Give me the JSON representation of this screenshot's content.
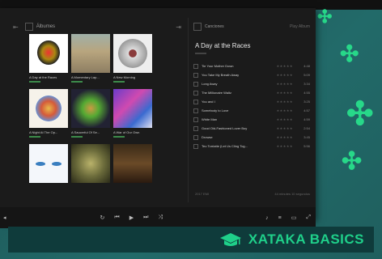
{
  "app": {
    "albums_pane": {
      "title": "Álbumes"
    },
    "albums": [
      {
        "label": "A Day at the Races"
      },
      {
        "label": "A Momentary Lap..."
      },
      {
        "label": "A New Morning"
      },
      {
        "label": "A Night At The Op..."
      },
      {
        "label": "A Saucerful Of Se..."
      },
      {
        "label": "A War of Our Own"
      },
      {
        "label": ""
      },
      {
        "label": ""
      },
      {
        "label": ""
      }
    ],
    "tracks_pane": {
      "title": "Canciones",
      "action": "Play Album",
      "album_title": "A Day at the Races"
    },
    "tracks": [
      {
        "name": "Tie Your Mother Down",
        "time": "4:48"
      },
      {
        "name": "You Take My Breath Away",
        "time": "5:09"
      },
      {
        "name": "Long Away",
        "time": "3:34"
      },
      {
        "name": "The Millionaire Waltz",
        "time": "4:55"
      },
      {
        "name": "You and I",
        "time": "3:25"
      },
      {
        "name": "Somebody to Love",
        "time": "4:57"
      },
      {
        "name": "White Man",
        "time": "4:59"
      },
      {
        "name": "Good Old-Fashioned Lover Boy",
        "time": "2:54"
      },
      {
        "name": "Drowse",
        "time": "3:45"
      },
      {
        "name": "Teo Torriatte (Let Us Cling Tog...",
        "time": "5:56"
      }
    ],
    "footer_left": "2017 EMI",
    "footer_right": "44 minutes 10 segundos"
  },
  "brand": {
    "text": "XATAKA BASICS",
    "accent": "#1fd08a"
  }
}
